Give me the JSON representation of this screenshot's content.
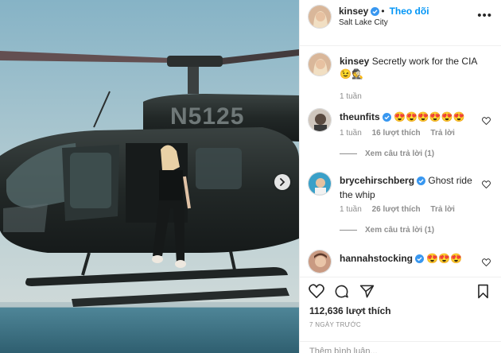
{
  "post": {
    "author": "kinsey",
    "follow_label": "Theo dõi",
    "dot": "•",
    "location": "Salt Lake City",
    "tail_number": "N5125"
  },
  "caption": {
    "author": "kinsey",
    "text": "Secretly work for the CIA 😉🕵",
    "time": "1 tuần"
  },
  "comments": [
    {
      "author": "theunfits",
      "text": "😍😍😍😍😍😍",
      "time": "1 tuần",
      "likes": "16 lượt thích",
      "reply": "Trả lời",
      "view_replies": "Xem câu trả lời (1)"
    },
    {
      "author": "brycehirschberg",
      "text": "Ghost ride the whip",
      "time": "1 tuần",
      "likes": "26 lượt thích",
      "reply": "Trả lời",
      "view_replies": "Xem câu trả lời (1)"
    },
    {
      "author": "hannahstocking",
      "text": "😍😍😍"
    }
  ],
  "footer": {
    "likes": "112,636 lượt thích",
    "time_ago": "7 NGÀY TRƯỚC",
    "add_comment_placeholder": "Thêm bình luận..."
  },
  "icons": {
    "more": "more-options-icon",
    "heart": "heart-icon",
    "comment": "comment-icon",
    "share": "share-icon",
    "save": "bookmark-icon",
    "verified": "verified-badge-icon",
    "next": "chevron-right-icon"
  },
  "colors": {
    "link_blue": "#0095f6",
    "verified_blue": "#3897f0",
    "text": "#262626",
    "muted": "#8e8e8e"
  }
}
